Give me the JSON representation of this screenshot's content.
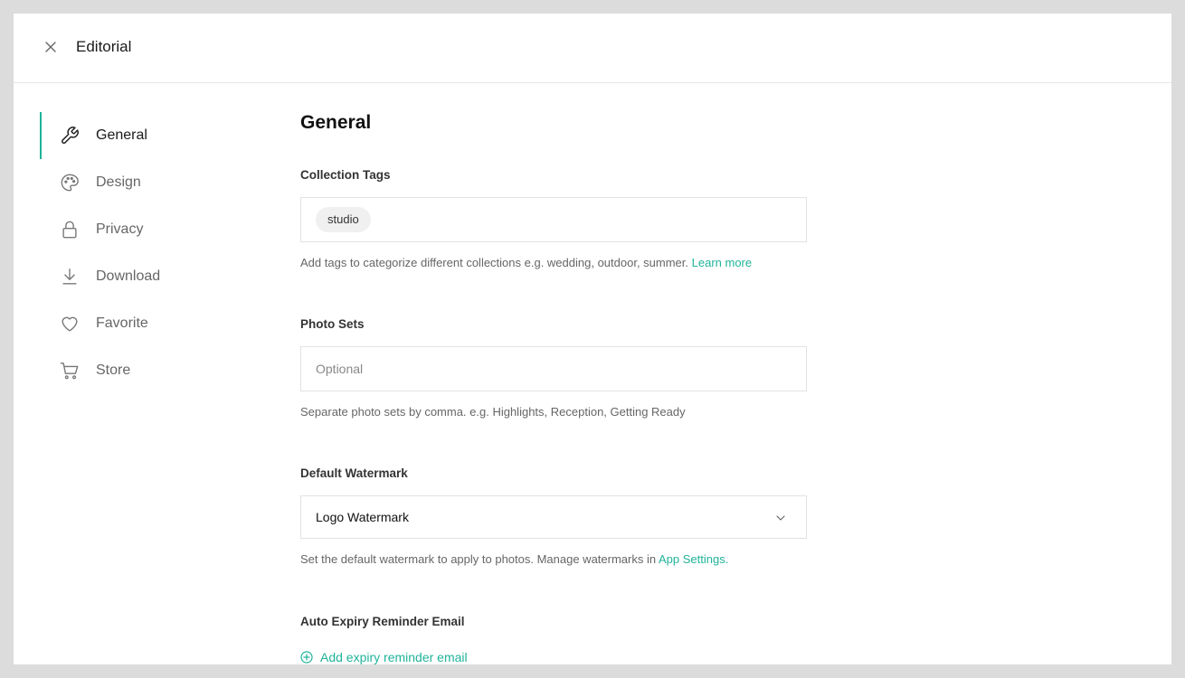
{
  "header": {
    "title": "Editorial",
    "close_icon": "close-icon"
  },
  "sidebar": {
    "items": [
      {
        "label": "General",
        "icon": "wrench-icon",
        "active": true
      },
      {
        "label": "Design",
        "icon": "palette-icon",
        "active": false
      },
      {
        "label": "Privacy",
        "icon": "lock-icon",
        "active": false
      },
      {
        "label": "Download",
        "icon": "download-icon",
        "active": false
      },
      {
        "label": "Favorite",
        "icon": "heart-icon",
        "active": false
      },
      {
        "label": "Store",
        "icon": "cart-icon",
        "active": false
      }
    ]
  },
  "main": {
    "title": "General",
    "collection_tags": {
      "label": "Collection Tags",
      "tags": [
        "studio"
      ],
      "help": "Add tags to categorize different collections e.g. wedding, outdoor, summer.",
      "help_link": "Learn more"
    },
    "photo_sets": {
      "label": "Photo Sets",
      "placeholder": "Optional",
      "value": "",
      "help": "Separate photo sets by comma. e.g. Highlights, Reception, Getting Ready"
    },
    "watermark": {
      "label": "Default Watermark",
      "selected": "Logo Watermark",
      "help_prefix": "Set the default watermark to apply to photos. Manage watermarks in",
      "help_link": "App Settings",
      "help_suffix": "."
    },
    "expiry": {
      "label": "Auto Expiry Reminder Email",
      "add_label": "Add expiry reminder email"
    }
  },
  "colors": {
    "accent": "#20b39a",
    "background": "#dcdcdc",
    "panel": "#ffffff"
  }
}
